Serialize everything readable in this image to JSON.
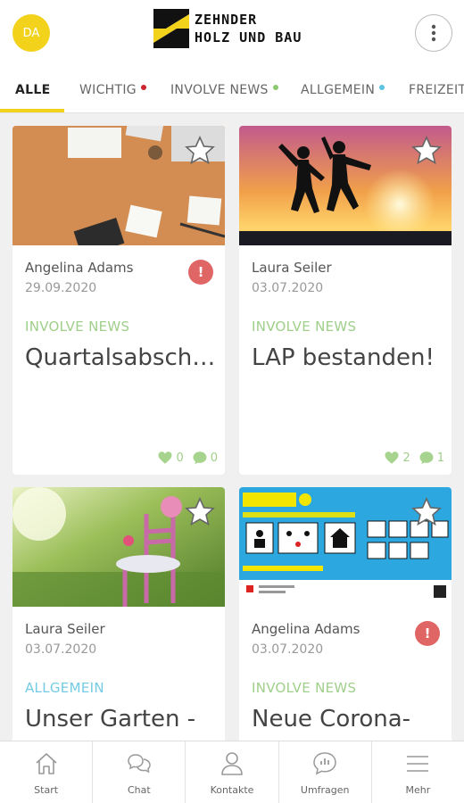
{
  "header": {
    "avatar_initials": "DA",
    "logo_line1": "ZEHNDER",
    "logo_line2": "HOLZ UND BAU",
    "menu_icon": "kebab-menu-icon"
  },
  "tabs": [
    {
      "label": "ALLE",
      "active": true
    },
    {
      "label": "WICHTIG",
      "dot_color": "#d0222f"
    },
    {
      "label": "INVOLVE NEWS",
      "dot_color": "#8cc86e"
    },
    {
      "label": "ALLGEMEIN",
      "dot_color": "#5bc4e0"
    },
    {
      "label": "FREIZEIT"
    }
  ],
  "colors": {
    "brand_yellow": "#f2d21a",
    "involve_news": "#9fcf8a",
    "allgemein": "#74cbe3",
    "alert": "#e06666"
  },
  "cards": [
    {
      "author": "Angelina Adams",
      "date": "29.09.2020",
      "important": true,
      "alert_symbol": "!",
      "category": "INVOLVE NEWS",
      "title": "Quartalsabsch…",
      "likes": "0",
      "comments": "0"
    },
    {
      "author": "Laura Seiler",
      "date": "03.07.2020",
      "important": false,
      "category": "INVOLVE NEWS",
      "title": "LAP bestanden!",
      "likes": "2",
      "comments": "1"
    },
    {
      "author": "Laura Seiler",
      "date": "03.07.2020",
      "important": false,
      "category": "ALLGEMEIN",
      "title": "Unser Garten -"
    },
    {
      "author": "Angelina Adams",
      "date": "03.07.2020",
      "important": true,
      "alert_symbol": "!",
      "category": "INVOLVE NEWS",
      "title": "Neue Corona-"
    }
  ],
  "bottom_nav": [
    {
      "label": "Start",
      "icon": "home-icon"
    },
    {
      "label": "Chat",
      "icon": "chat-icon"
    },
    {
      "label": "Kontakte",
      "icon": "contacts-icon"
    },
    {
      "label": "Umfragen",
      "icon": "survey-icon"
    },
    {
      "label": "Mehr",
      "icon": "hamburger-icon"
    }
  ]
}
